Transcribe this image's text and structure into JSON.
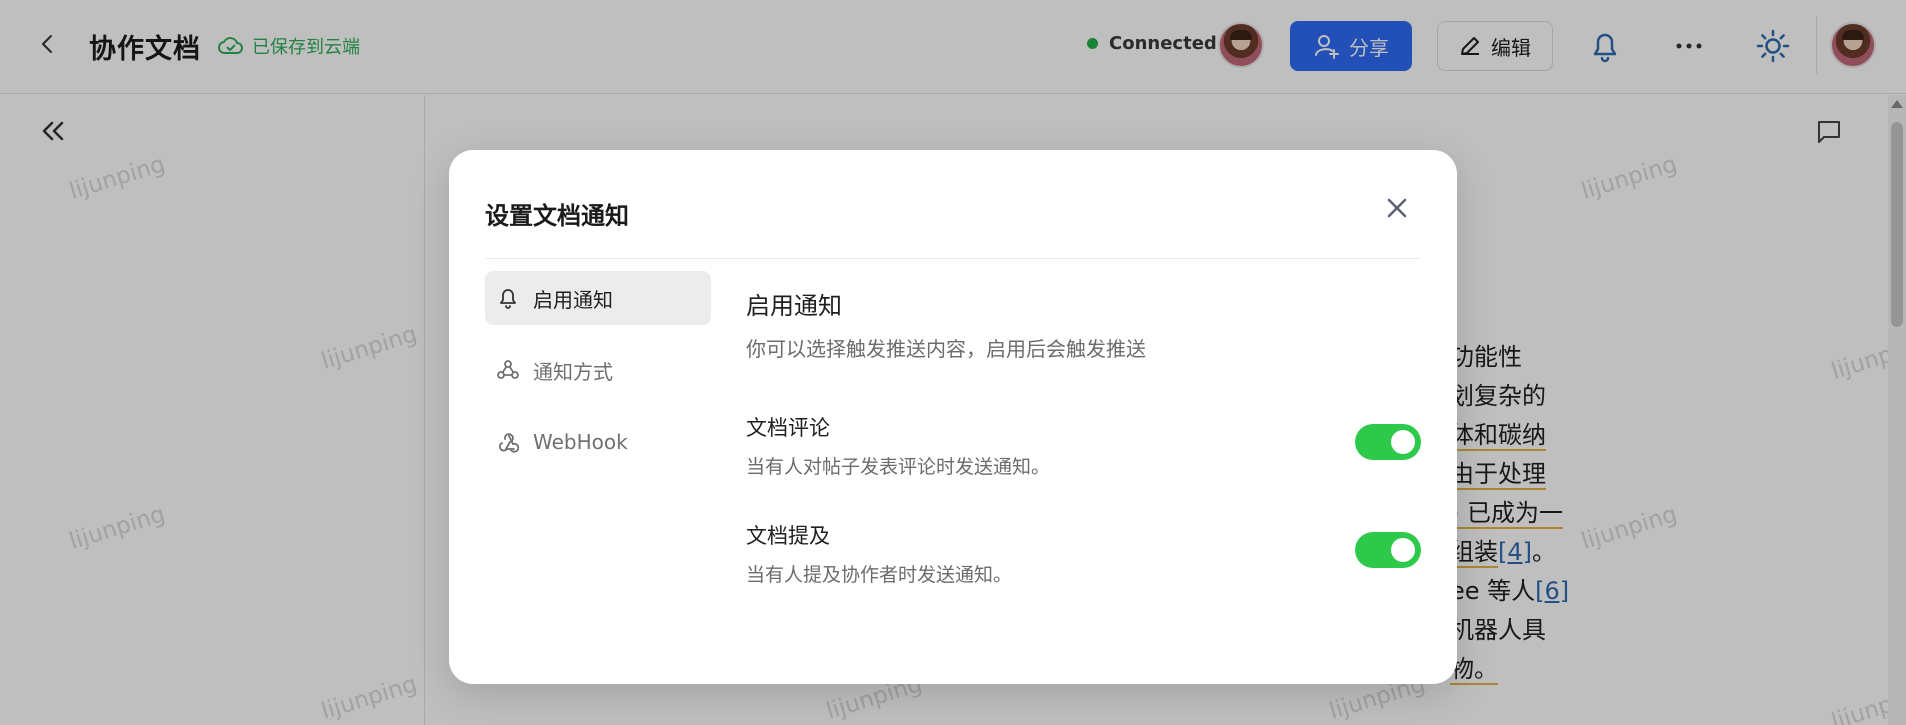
{
  "header": {
    "title": "协作文档",
    "saved_status": "已保存到云端",
    "connection_status": "Connected",
    "share_label": "分享",
    "edit_label": "编辑"
  },
  "watermark_text": "lijunping",
  "article_fragments": [
    "功能性",
    "划复杂的",
    "体和碳纳",
    "由于处理",
    ") 已成为一",
    "组装",
    "[4]",
    "。",
    "ee 等人",
    "[6]",
    "机器人具",
    "物。"
  ],
  "modal": {
    "title": "设置文档通知",
    "menu": [
      {
        "label": "启用通知",
        "icon": "bell-icon",
        "active": true
      },
      {
        "label": "通知方式",
        "icon": "share-nodes-icon",
        "active": false
      },
      {
        "label": "WebHook",
        "icon": "webhook-icon",
        "active": false
      }
    ],
    "section_title": "启用通知",
    "section_desc": "你可以选择触发推送内容，启用后会触发推送",
    "settings": [
      {
        "label": "文档评论",
        "desc": "当有人对帖子发表评论时发送通知。",
        "enabled": true
      },
      {
        "label": "文档提及",
        "desc": "当有人提及协作者时发送通知。",
        "enabled": true
      }
    ]
  },
  "colors": {
    "accent": "#2f6bf5",
    "saved_green": "#2fae58",
    "toggle_on": "#2ec94a",
    "status_dot": "#22b04b"
  }
}
